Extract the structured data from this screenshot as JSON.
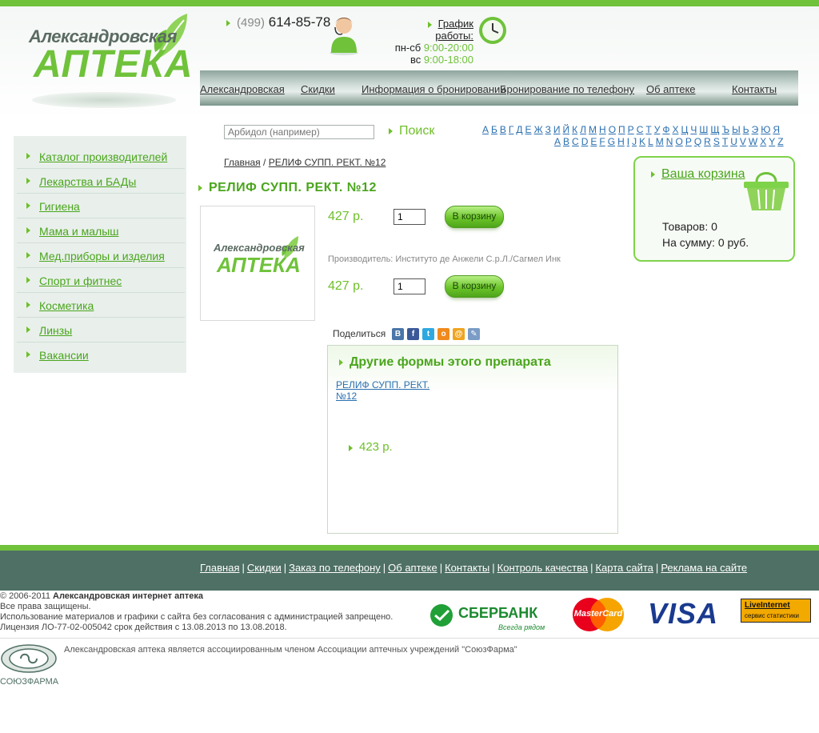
{
  "brand": {
    "logo_top": "Александровская",
    "logo_main": "АПТЕКА"
  },
  "contact": {
    "phone_code": "(499)",
    "phone_number": "614-85-78"
  },
  "schedule": {
    "title": "График работы:",
    "weekday_label": "пн-сб",
    "weekday_time": "9:00-20:00",
    "sunday_label": "вс",
    "sunday_time": "9:00-18:00"
  },
  "nav": [
    "Александровская",
    "Скидки",
    "Информация о бронировании",
    "Бронирование по телефону",
    "Об аптеке",
    "Контакты"
  ],
  "search": {
    "placeholder": "Арбидол (например)",
    "button": "Поиск"
  },
  "alphabet_ru": [
    "А",
    "Б",
    "В",
    "Г",
    "Д",
    "Е",
    "Ж",
    "З",
    "И",
    "Й",
    "К",
    "Л",
    "М",
    "Н",
    "О",
    "П",
    "Р",
    "С",
    "Т",
    "У",
    "Ф",
    "Х",
    "Ц",
    "Ч",
    "Ш",
    "Щ",
    "Ъ",
    "Ы",
    "Ь",
    "Э",
    "Ю",
    "Я"
  ],
  "alphabet_en": [
    "A",
    "B",
    "C",
    "D",
    "E",
    "F",
    "G",
    "H",
    "I",
    "J",
    "K",
    "L",
    "M",
    "N",
    "O",
    "P",
    "Q",
    "R",
    "S",
    "T",
    "U",
    "V",
    "W",
    "X",
    "Y",
    "Z"
  ],
  "sidebar": [
    "Каталог производителей",
    "Лекарства и БАДы",
    "Гигиена",
    "Мама и малыш",
    "Мед.приборы и изделия",
    "Спорт и фитнес",
    "Косметика",
    "Линзы",
    "Вакансии"
  ],
  "breadcrumb": {
    "home": "Главная",
    "separator": "/",
    "current": "РЕЛИФ СУПП. РЕКТ. №12"
  },
  "product": {
    "title": "РЕЛИФ СУПП. РЕКТ. №12",
    "image_logo_top": "Александровская",
    "image_logo_main": "АПТЕКА",
    "offers": [
      {
        "price": "427 р.",
        "qty": "1",
        "button": "В корзину"
      },
      {
        "price": "427 р.",
        "qty": "1",
        "button": "В корзину"
      }
    ],
    "manufacturer": "Производитель: Институто де Анжели С.р.Л./Сагмел Инк"
  },
  "share": {
    "label": "Поделиться",
    "icons": [
      "vkontakte-icon",
      "facebook-icon",
      "twitter-icon",
      "odnoklassniki-icon",
      "mail-icon",
      "livejournal-icon"
    ]
  },
  "other_forms": {
    "title": "Другие формы этого препарата",
    "link": "РЕЛИФ СУПП. РЕКТ. №12",
    "price": "423 р."
  },
  "basket": {
    "title": "Ваша корзина",
    "items": "Товаров: 0",
    "sum": "На сумму: 0 руб."
  },
  "footer": {
    "links": [
      "Главная",
      "Скидки",
      "Заказ по телефону",
      "Об аптеке",
      "Контакты",
      "Контроль качества",
      "Карта сайта",
      "Реклама на сайте"
    ],
    "copyright_prefix": "© 2006-2011",
    "copyright_name": "Александровская интернет аптека",
    "rights": "Все права защищены.",
    "notice": "Использование материалов и графики с сайта без согласования с администрацией запрещено.",
    "license": "Лицензия ЛО-77-02-005042 срок действия с 13.08.2013 по 13.08.2018.",
    "association": "Александровская аптека является ассоциированным членом Ассоциации аптечных учреждений \"СоюзФарма\"",
    "soyuz": "СОЮЗФАРМА",
    "sberbank": "СБЕРБАНК",
    "sberbank_tagline": "Всегда рядом",
    "mastercard": "MasterCard",
    "visa": "VISA",
    "liveinternet": "LiveInternet",
    "liveinternet_sub": "сервис статистики"
  },
  "colors": {
    "brand_green": "#6fc23a",
    "link_green": "#4aa51c",
    "footer_bg": "#4f7064"
  }
}
